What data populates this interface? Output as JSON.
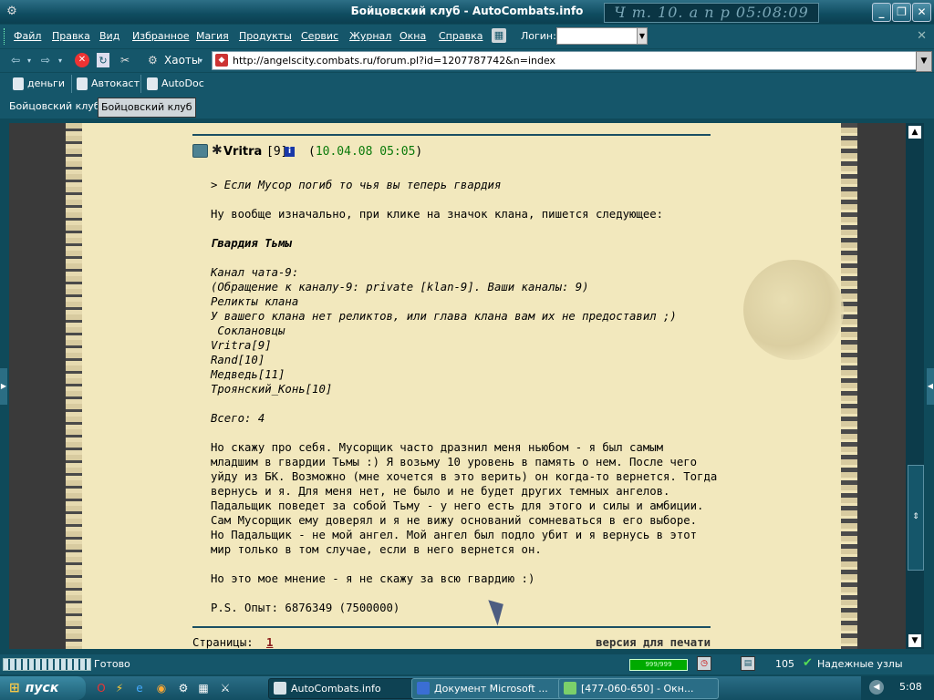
{
  "window": {
    "title": "Бойцовский клуб - AutoCombats.info",
    "clock": "Ч т. 10. а п р 05:08:09"
  },
  "menu": {
    "items": [
      "Файл",
      "Правка",
      "Вид",
      "Избранное",
      "Магия",
      "Продукты",
      "Сервис",
      "Журнал",
      "Окна",
      "Справка"
    ],
    "login_label": "Логин:",
    "login_value": ""
  },
  "nav": {
    "back": "⇦",
    "forward": "⇨",
    "haoty_label": "Хаоты",
    "url": "http://angelscity.combats.ru/forum.pl?id=1207787742&n=index"
  },
  "links": [
    "деньги",
    "Автокаст",
    "AutoDoc"
  ],
  "tabs": [
    "Бойцовский клуб",
    "Бойцовский клуб"
  ],
  "post": {
    "author": "Vritra",
    "level": "[9]",
    "date": "10.04.08 05:05",
    "lines": [
      {
        "t": "it",
        "text": "> Если Мусор погиб то чья вы теперь гвардия"
      },
      {
        "t": "n",
        "text": ""
      },
      {
        "t": "n",
        "text": "Ну вообще изначально, при клике на значок клана, пишется следующее:"
      },
      {
        "t": "n",
        "text": ""
      },
      {
        "t": "bi",
        "text": "Гвардия Тьмы"
      },
      {
        "t": "n",
        "text": ""
      },
      {
        "t": "it",
        "text": "Канал чата-9:"
      },
      {
        "t": "it",
        "text": "(Обращение к каналу-9: private [klan-9]. Ваши каналы: 9)"
      },
      {
        "t": "it",
        "text": "Реликты клана"
      },
      {
        "t": "it",
        "text": "У вашего клана нет реликтов, или глава клана вам их не предоставил ;)"
      },
      {
        "t": "it",
        "text": " Соклановцы"
      },
      {
        "t": "it",
        "text": "Vritra[9]"
      },
      {
        "t": "it",
        "text": "Rand[10]"
      },
      {
        "t": "it",
        "text": "Медведь[11]"
      },
      {
        "t": "it",
        "text": "Троянский_Конь[10]"
      },
      {
        "t": "n",
        "text": ""
      },
      {
        "t": "it",
        "text": "Всего: 4"
      },
      {
        "t": "n",
        "text": ""
      },
      {
        "t": "n",
        "text": "Но скажу про себя. Мусорщик часто дразнил меня ньюбом - я был самым"
      },
      {
        "t": "n",
        "text": "младшим в гвардии Тьмы :) Я возьму 10 уровень в память о нем. После чего"
      },
      {
        "t": "n",
        "text": "уйду из БК. Возможно (мне хочется в это верить) он когда-то вернется. Тогда"
      },
      {
        "t": "n",
        "text": "вернусь и я. Для меня нет, не было и не будет других темных ангелов."
      },
      {
        "t": "n",
        "text": "Падальщик поведет за собой Тьму - у него есть для этого и силы и амбиции."
      },
      {
        "t": "n",
        "text": "Сам Мусорщик ему доверял и я не вижу оснований сомневаться в его выборе."
      },
      {
        "t": "n",
        "text": "Но Падальщик - не мой ангел. Мой ангел был подло убит и я вернусь в этот"
      },
      {
        "t": "n",
        "text": "мир только в том случае, если в него вернется он."
      },
      {
        "t": "n",
        "text": ""
      },
      {
        "t": "n",
        "text": "Но это мое мнение - я не скажу за всю гвардию :)"
      },
      {
        "t": "n",
        "text": ""
      },
      {
        "t": "n",
        "text": "P.S. Опыт: 6876349 (7500000)"
      }
    ],
    "pages_label": "Страницы:",
    "page_current": "1",
    "print_link": "версия для печати"
  },
  "status": {
    "text": "Готово",
    "memory": "999/999",
    "zoom": "105",
    "zone": "Надежные узлы"
  },
  "taskbar": {
    "start": "пуск",
    "tasks": [
      "AutoCombats.info",
      "Документ Microsoft ...",
      "[477-060-650] - Окн..."
    ],
    "time": "5:08"
  }
}
